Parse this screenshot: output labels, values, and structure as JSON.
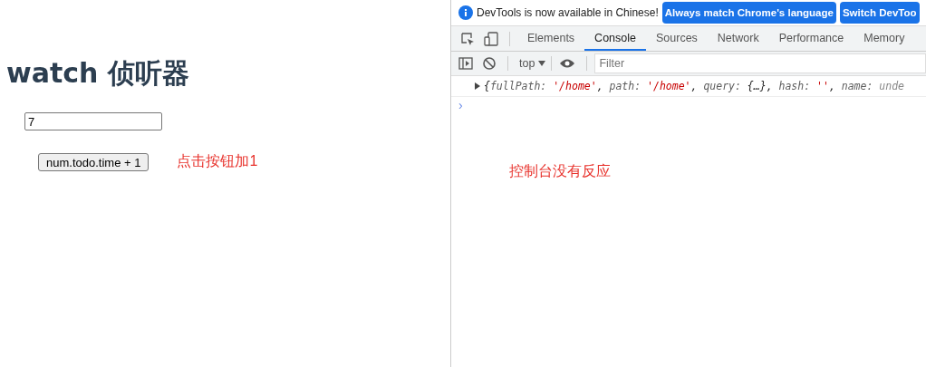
{
  "page": {
    "heading": "watch 侦听器",
    "input_value": "7",
    "button_label": "num.todo.time + 1",
    "note": "点击按钮加1"
  },
  "devtools": {
    "infobar": {
      "message": "DevTools is now available in Chinese!",
      "buttons": [
        "Always match Chrome's language",
        "Switch DevToo"
      ]
    },
    "tabs": [
      {
        "label": "Elements",
        "selected": false
      },
      {
        "label": "Console",
        "selected": true
      },
      {
        "label": "Sources",
        "selected": false
      },
      {
        "label": "Network",
        "selected": false
      },
      {
        "label": "Performance",
        "selected": false
      },
      {
        "label": "Memory",
        "selected": false
      }
    ],
    "context": "top",
    "filter_placeholder": "Filter",
    "log": [
      {
        "kind": "punct",
        "text": "{"
      },
      {
        "kind": "key",
        "text": "fullPath: "
      },
      {
        "kind": "string",
        "text": "'/home'"
      },
      {
        "kind": "punct",
        "text": ", "
      },
      {
        "kind": "key",
        "text": "path: "
      },
      {
        "kind": "string",
        "text": "'/home'"
      },
      {
        "kind": "punct",
        "text": ", "
      },
      {
        "kind": "key",
        "text": "query: "
      },
      {
        "kind": "punct",
        "text": "{…}, "
      },
      {
        "kind": "key",
        "text": "hash: "
      },
      {
        "kind": "string",
        "text": "''"
      },
      {
        "kind": "punct",
        "text": ", "
      },
      {
        "kind": "key",
        "text": "name: "
      },
      {
        "kind": "muted",
        "text": "unde"
      }
    ],
    "prompt": "›",
    "note": "控制台没有反应"
  }
}
